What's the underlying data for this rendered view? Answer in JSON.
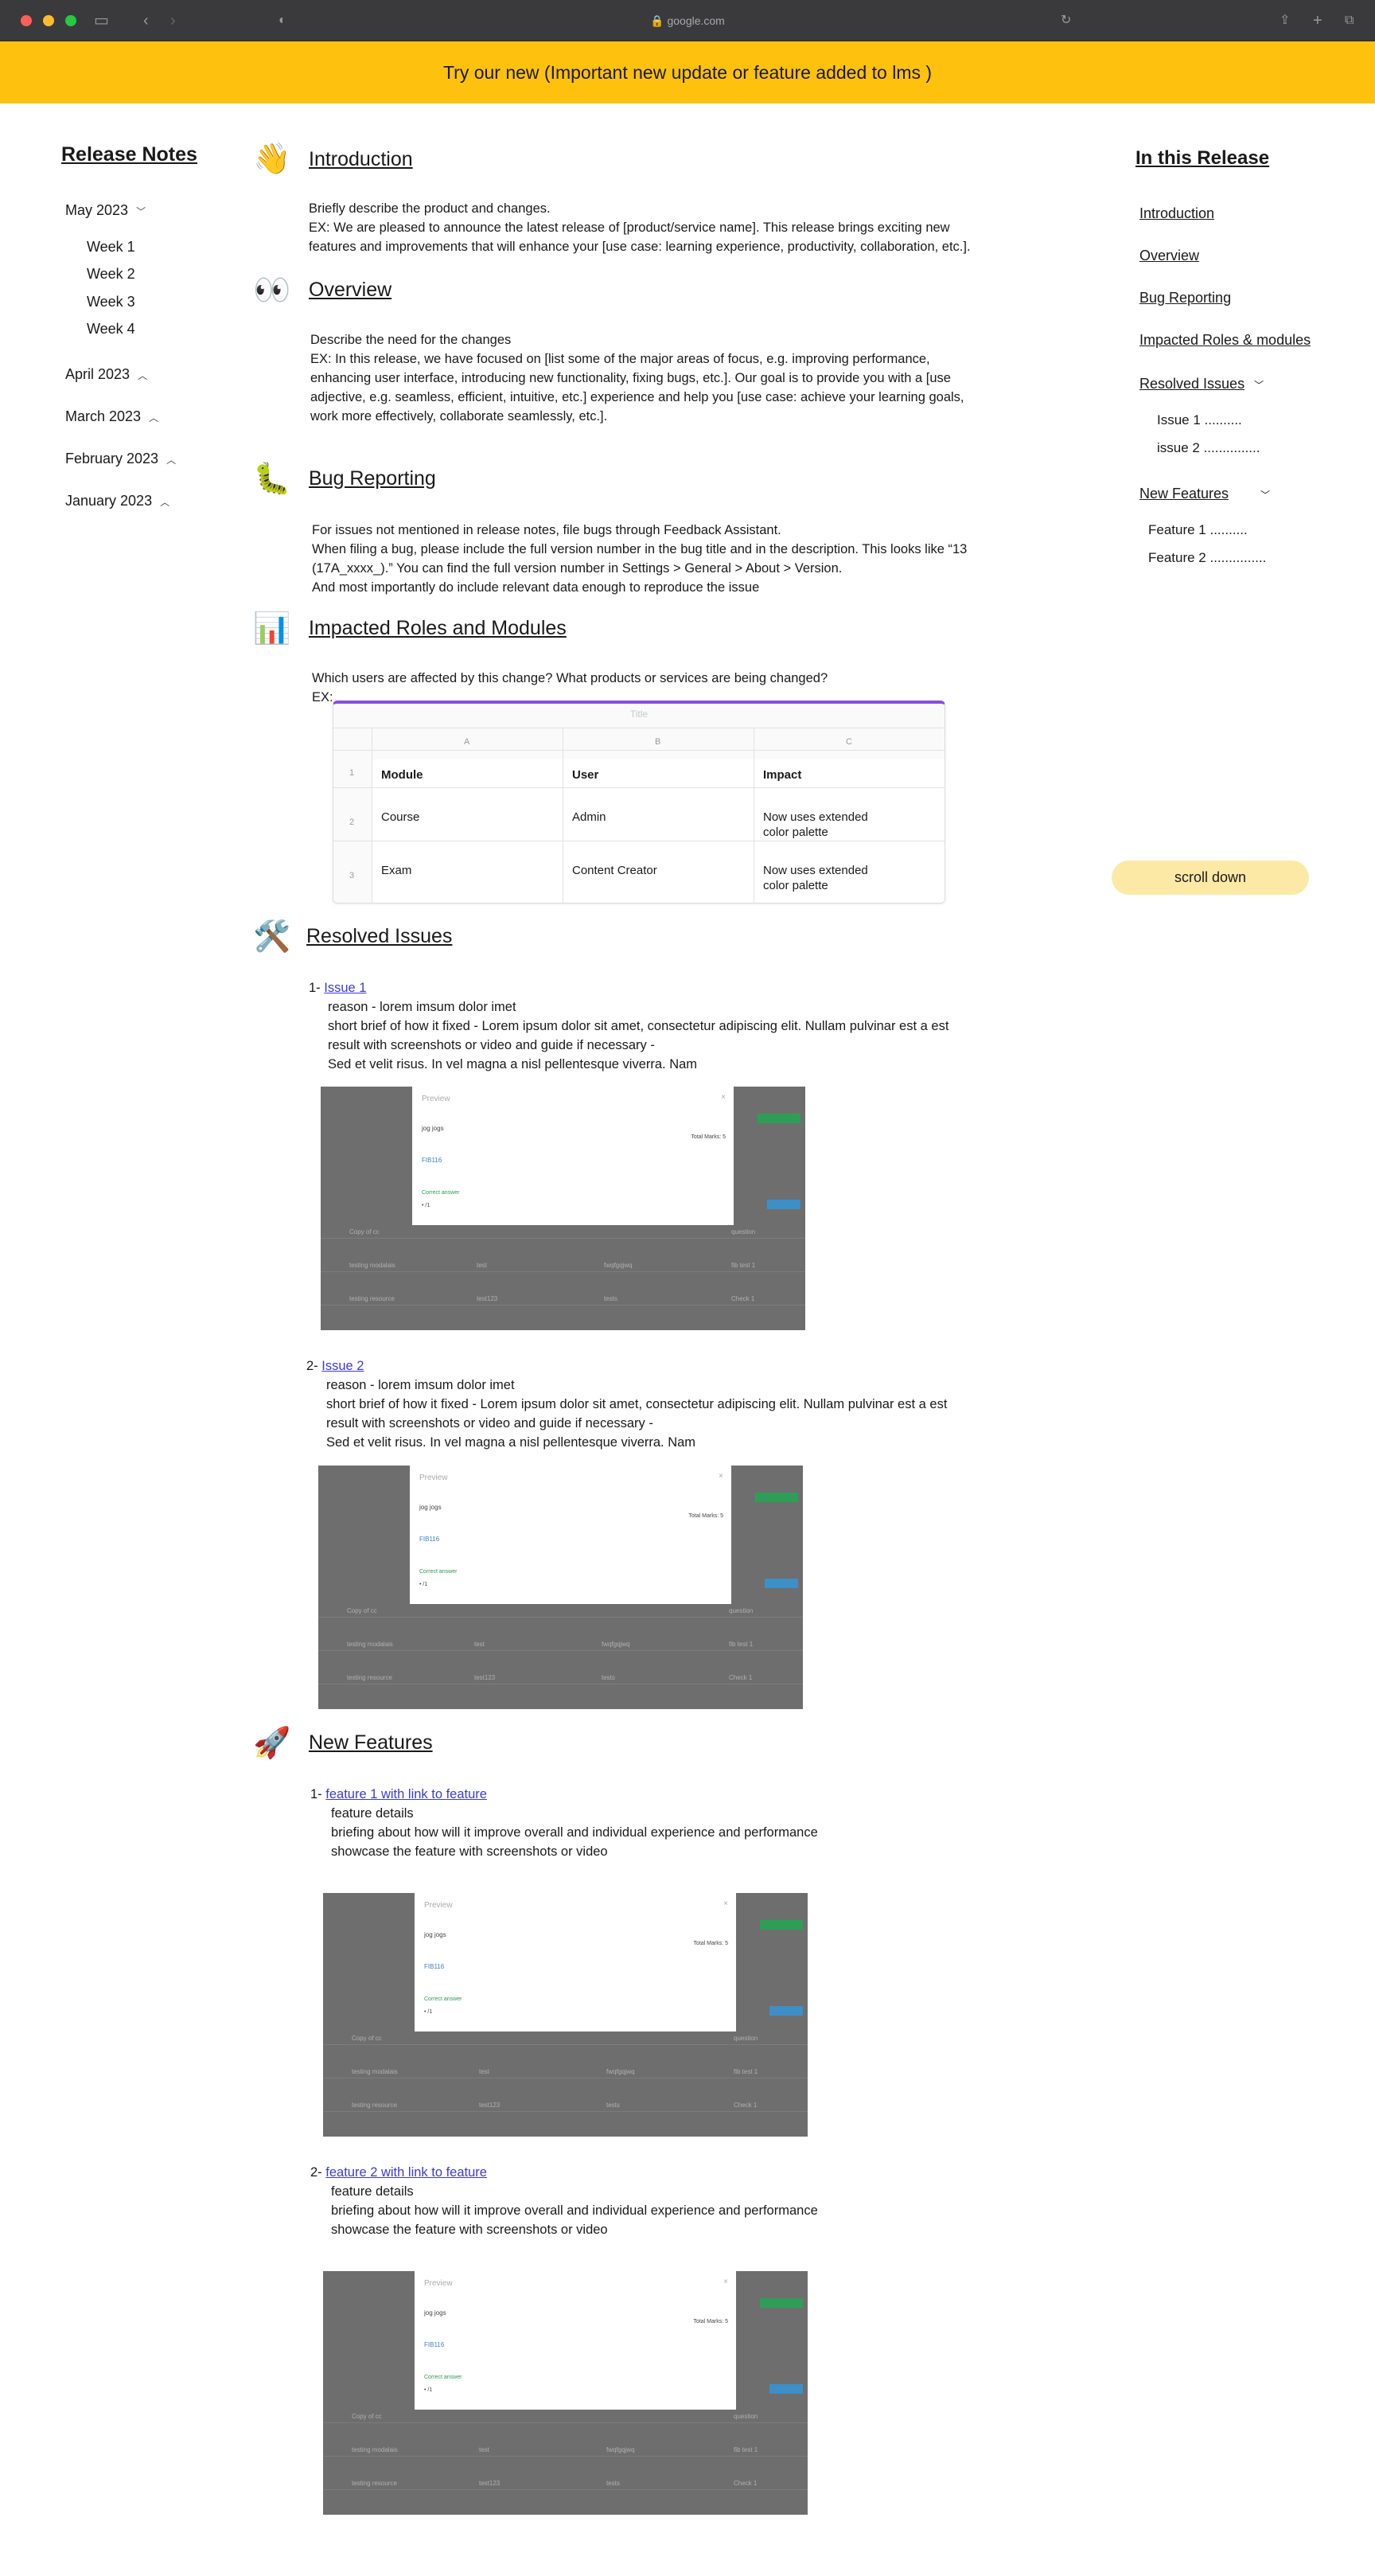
{
  "browser": {
    "url": "google.com"
  },
  "banner": {
    "text": "Try our new (Important new update or feature added to lms )"
  },
  "left_sidebar": {
    "title": "Release Notes",
    "months": [
      {
        "label": "May 2023",
        "expanded": true,
        "weeks": [
          "Week 1",
          "Week 2",
          "Week 3",
          "Week 4"
        ]
      },
      {
        "label": "April 2023",
        "expanded": false
      },
      {
        "label": "March 2023",
        "expanded": false
      },
      {
        "label": "February 2023",
        "expanded": false
      },
      {
        "label": "January 2023",
        "expanded": false
      }
    ]
  },
  "right_sidebar": {
    "title": "In this Release",
    "items": [
      "Introduction",
      "Overview",
      "Bug Reporting",
      "Impacted Roles & modules",
      "Resolved Issues",
      "New Features"
    ],
    "resolved_sub": [
      "Issue 1 ..........",
      "issue 2 ..............."
    ],
    "features_sub": [
      "Feature 1 ..........",
      "Feature 2 ..............."
    ],
    "scroll_button": "scroll down"
  },
  "sections": {
    "introduction": {
      "icon": "👋",
      "title": "Introduction",
      "line1": "Briefly describe the product and changes.",
      "line2": "EX: We are pleased to announce the latest release of [product/service name]. This release brings exciting new",
      "line3": "features and improvements that will enhance your [use case: learning experience, productivity, collaboration, etc.]."
    },
    "overview": {
      "icon": "👀",
      "title": "Overview",
      "line1": "Describe the need for the changes",
      "line2": "EX: In this release, we have focused on [list some of the major areas of focus, e.g. improving performance,",
      "line3": "enhancing user interface, introducing new functionality, fixing bugs, etc.]. Our goal is to provide you with a [use",
      "line4": "adjective, e.g. seamless, efficient, intuitive, etc.] experience and help you [use case: achieve your learning goals,",
      "line5": "work more effectively, collaborate seamlessly, etc.]."
    },
    "bug_reporting": {
      "icon": "🐛",
      "title": "Bug Reporting",
      "line1": "For issues not mentioned in release notes, file bugs through Feedback Assistant.",
      "line2": "When filing a bug, please include the full version number in the bug title and in the description. This looks like “13",
      "line3": "(17A_xxxx_).” You can find the full version number in Settings > General > About > Version.",
      "line4": "And most importantly do include relevant data enough to reproduce the issue"
    },
    "impacted": {
      "icon": "📊",
      "title": "Impacted Roles and Modules",
      "line1": "Which users are affected by this change? What products or services are being changed?",
      "line2": "EX:",
      "table": {
        "title": "Title",
        "col_letters": [
          "A",
          "B",
          "C"
        ],
        "row_numbers": [
          "1",
          "2",
          "3"
        ],
        "header": [
          "Module",
          "User",
          "Impact"
        ],
        "rows": [
          [
            "Course",
            "Admin",
            "Now uses extended",
            "color palette"
          ],
          [
            "Exam",
            "Content Creator",
            "Now uses extended",
            "color palette"
          ]
        ]
      }
    },
    "resolved": {
      "icon": "🛠️",
      "title": "Resolved Issues",
      "issues": [
        {
          "num": "1- ",
          "link": "Issue 1 ",
          "reason": "reason - lorem imsum dolor imet",
          "brief1": "short brief of how it fixed - Lorem ipsum dolor sit amet, consectetur adipiscing elit. Nullam pulvinar est a est",
          "brief2": "result with screenshots or video and guide if necessary -",
          "brief3": "Sed et velit risus. In vel magna a nisl pellentesque viverra. Nam"
        },
        {
          "num": "2- ",
          "link": "Issue 2 ",
          "reason": "reason - lorem imsum dolor imet",
          "brief1": "short brief of how it fixed - Lorem ipsum dolor sit amet, consectetur adipiscing elit. Nullam pulvinar est a est",
          "brief2": "result with screenshots or video and guide if necessary -",
          "brief3": "Sed et velit risus. In vel magna a nisl pellentesque viverra. Nam"
        }
      ]
    },
    "features": {
      "icon": "🚀",
      "title": "New Features",
      "items": [
        {
          "num": "1- ",
          "link": "feature 1 with link to feature ",
          "details": "feature details",
          "brief": "briefing about how will it improve overall and individual experience and performance",
          "showcase": "showcase the feature with screenshots or video"
        },
        {
          "num": "2- ",
          "link": "feature 2 with link to feature ",
          "details": "feature details",
          "brief": "briefing about how will it improve overall and individual experience and performance",
          "showcase": "showcase the feature with screenshots or video"
        }
      ]
    }
  },
  "screenshot": {
    "dialog_title": "Preview",
    "dialog_close": "×",
    "question": "jog jogs",
    "total_marks": "Total Marks: 5",
    "answer_field": "FIB116",
    "correct_answer": "Correct answer",
    "answer_item": "• /1",
    "bg_labels": [
      "Copy of cc",
      "testing modalais",
      "testing resource",
      "test",
      "test123",
      "fwqfgqjwq",
      "tests",
      "question",
      "fib test 1",
      "Check 1"
    ]
  }
}
